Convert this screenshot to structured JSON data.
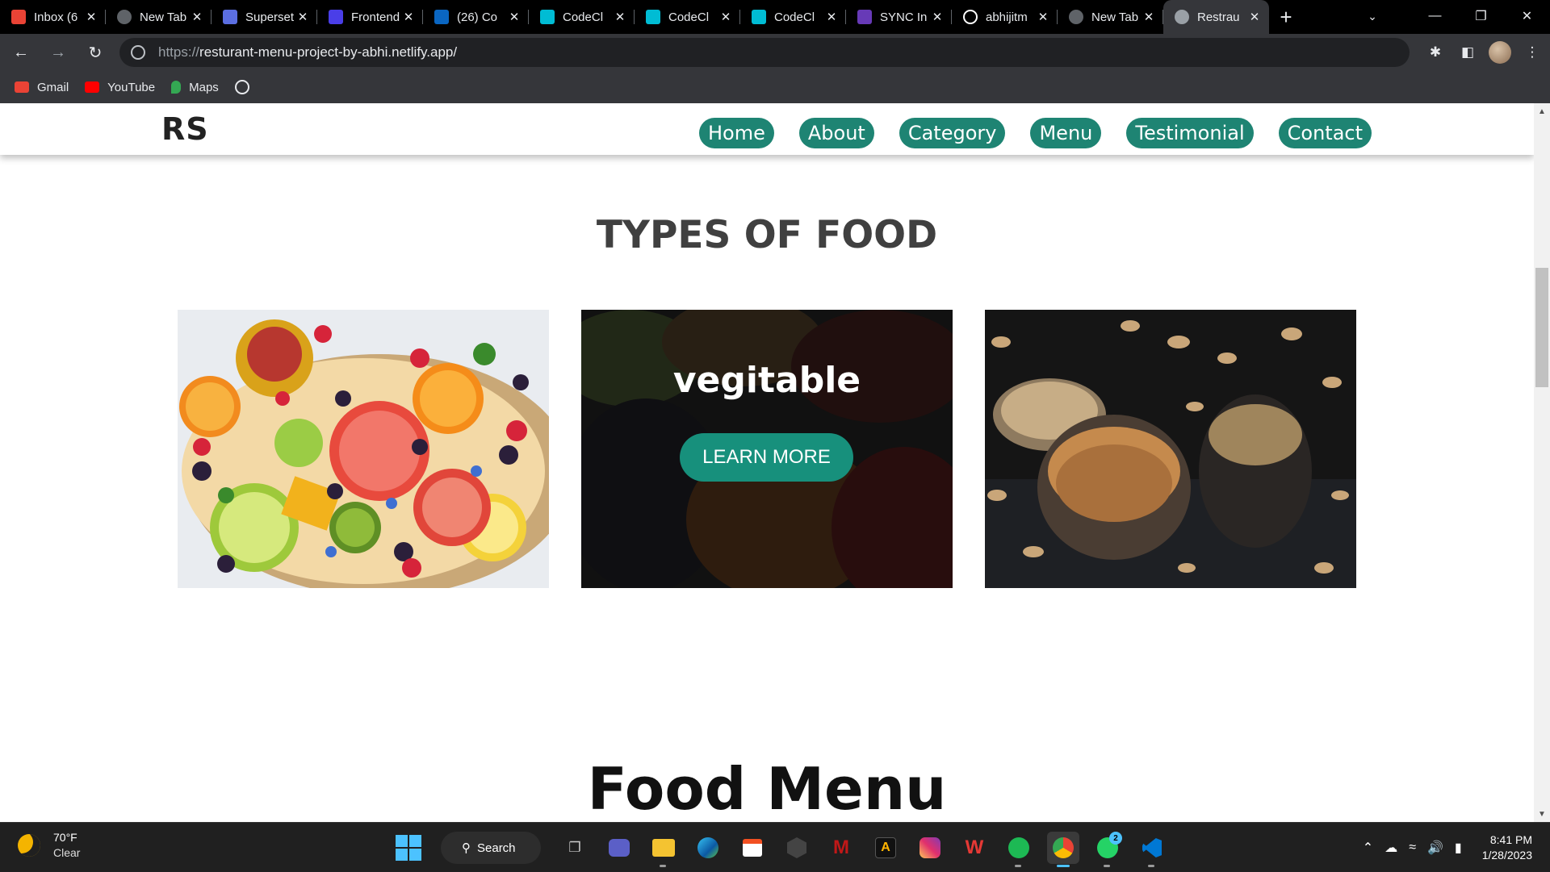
{
  "browser": {
    "tabs": [
      {
        "title": "Inbox (6",
        "favicon": "gmail-icon",
        "color": "#ea4335"
      },
      {
        "title": "New Tab",
        "favicon": "chrome-icon",
        "color": "#5f6368"
      },
      {
        "title": "Superset",
        "favicon": "superset-icon",
        "color": "#5b6ee1"
      },
      {
        "title": "Frontend",
        "favicon": "r-icon",
        "color": "#4a3ee8"
      },
      {
        "title": "(26) Co",
        "favicon": "linkedin-icon",
        "color": "#0a66c2"
      },
      {
        "title": "CodeCl",
        "favicon": "codeclause-icon",
        "color": "#00bcd4"
      },
      {
        "title": "CodeCl",
        "favicon": "codeclause-icon",
        "color": "#00bcd4"
      },
      {
        "title": "CodeCl",
        "favicon": "codeclause-icon",
        "color": "#00bcd4"
      },
      {
        "title": "SYNC In",
        "favicon": "form-icon",
        "color": "#673ab7"
      },
      {
        "title": "abhijitm",
        "favicon": "github-icon",
        "color": "#ffffff"
      },
      {
        "title": "New Tab",
        "favicon": "chrome-icon",
        "color": "#5f6368"
      },
      {
        "title": "Restrau",
        "favicon": "globe-icon",
        "color": "#9aa0a6",
        "active": true
      }
    ],
    "url_protocol": "https://",
    "url_host": "resturant-menu-project-by-abhi.netlify.app/",
    "bookmarks": [
      {
        "label": "Gmail",
        "color": "#ea4335"
      },
      {
        "label": "YouTube",
        "color": "#ff0000"
      },
      {
        "label": "Maps",
        "color": "#34a853"
      }
    ]
  },
  "site": {
    "logo": "RS",
    "nav": [
      "Home",
      "About",
      "Category",
      "Menu",
      "Testimonial",
      "Contact"
    ],
    "accent": "#1e8473",
    "section_title": "TYPES OF FOOD",
    "cards": [
      {
        "name": "fruits",
        "overlay": ""
      },
      {
        "name": "vegetable",
        "overlay": "vegitable",
        "button": "LEARN MORE"
      },
      {
        "name": "grains",
        "overlay": ""
      }
    ],
    "food_menu_title": "Food Menu"
  },
  "taskbar": {
    "weather_temp": "70°F",
    "weather_cond": "Clear",
    "search_label": "Search",
    "time": "8:41 PM",
    "date": "1/28/2023",
    "whatsapp_badge": "2"
  }
}
